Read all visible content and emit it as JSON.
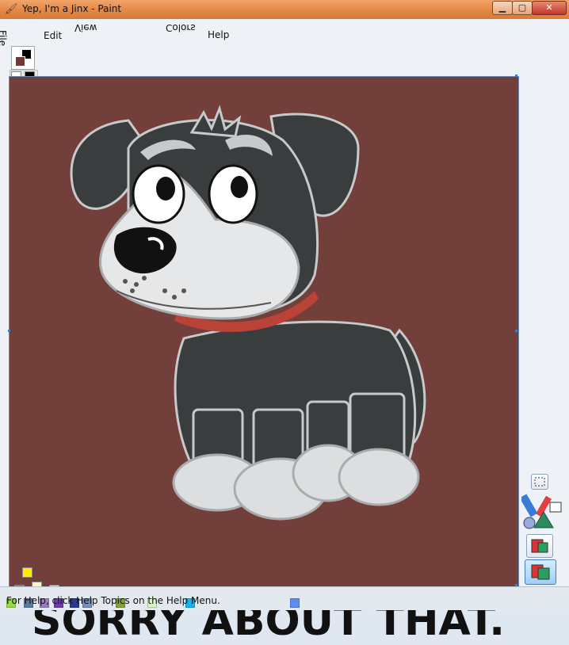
{
  "window": {
    "title": "Yep, I'm a Jinx - Paint",
    "minimize": "▁",
    "maximize": "▢",
    "close": "✕"
  },
  "menu": {
    "file": "File",
    "edit": "Edit",
    "view": "View",
    "colors": "Colors",
    "help": "Help"
  },
  "palette": {
    "current_fg": "#000000",
    "current_bg": "#6e3b37",
    "swatches": [
      "#ffffff",
      "#000000",
      "#c0c0c0",
      "#404040",
      "#a0a0a0",
      "#808080",
      "#8b5a2b",
      "#8b0000",
      "#ff9bb0",
      "#ff2020",
      "#e8a070",
      "#ff8c00",
      "#fff0a0",
      "#ffc000"
    ]
  },
  "canvas": {
    "background": "#733f3a",
    "caption": "SORRY ABOUT THAT."
  },
  "status": {
    "text": "For Help, click Help Topics on the Help Menu."
  }
}
